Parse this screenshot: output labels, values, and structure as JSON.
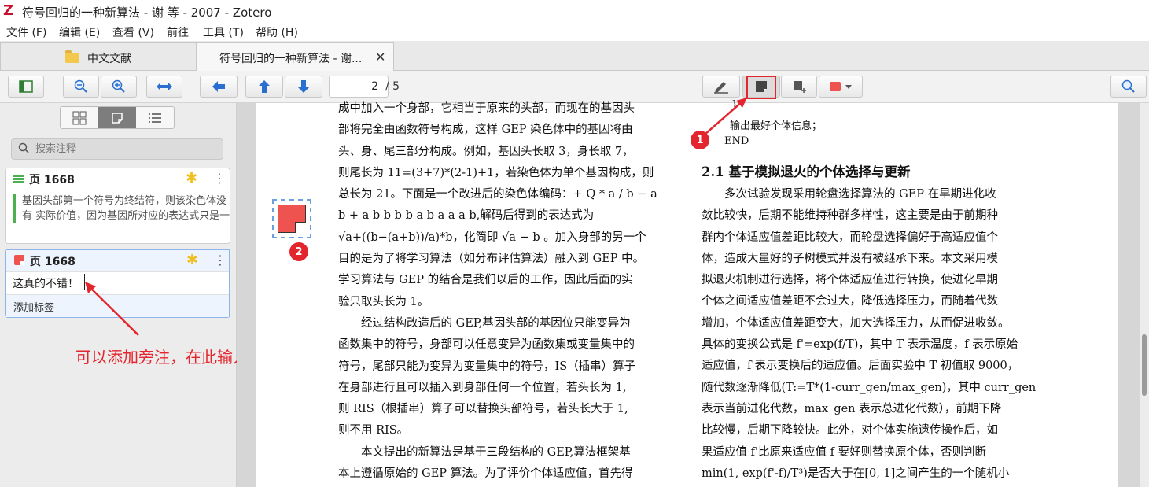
{
  "window": {
    "title": "符号回归的一种新算法 - 谢 等 - 2007 - Zotero",
    "app_logo": "Z"
  },
  "menu": [
    "文件 (F)",
    "编辑 (E)",
    "查看 (V)",
    "前往",
    "工具 (T)",
    "帮助 (H)"
  ],
  "tabs": [
    {
      "label": "中文文献",
      "icon": "folder-icon"
    },
    {
      "label": "符号回归的一种新算法 - 谢...",
      "icon": "none",
      "close": "✕"
    }
  ],
  "toolbar": {
    "current_page": "2",
    "total_pages": "/ 5"
  },
  "sidebar": {
    "search_placeholder": "搜索注释",
    "annotations": [
      {
        "page": "页 1668",
        "type": "highlight",
        "color": "#4caf50",
        "text": "基因头部第一个符号为终结符，则该染色体没有 实际价值，因为基因所对应的表达式只是一"
      },
      {
        "page": "页 1668",
        "type": "note",
        "color": "#ef5350",
        "comment": "这真的不错！",
        "tags_label": "添加标签"
      }
    ]
  },
  "hint_text": "可以添加旁注，在此输入内容",
  "badges": [
    "1",
    "2"
  ],
  "doc": {
    "left_lines": [
      "成中加入一个身部，它相当于原来的头部，而现在的基因头",
      "部将完全由函数符号构成，这样 GEP 染色体中的基因将由",
      "头、身、尾三部分构成。例如，基因头长取 3，身长取 7，",
      "则尾长为 11=(3+7)*(2-1)+1，若染色体为单个基因构成，则",
      "总长为 21。下面是一个改进后的染色体编码：+ Q * a / b − a",
      "b + a b b b b a b a a a b,解码后得到的表达式为",
      "√a+((b−(a+b))/a)*b，化简即 √a − b 。加入身部的另一个",
      "目的是为了将学习算法（如分布评估算法）融入到 GEP 中。",
      "学习算法与 GEP 的结合是我们以后的工作，因此后面的实",
      "验只取头长为 1。",
      "　　经过结构改造后的 GEP,基因头部的基因位只能变异为",
      "函数集中的符号，身部可以任意变异为函数集或变量集中的",
      "符号，尾部只能为变异为变量集中的符号，IS（插串）算子",
      "在身部进行且可以插入到身部任何一个位置，若头长为 1,",
      "则 RIS（根插串）算子可以替换头部符号，若头长大于 1,",
      "则不用 RIS。",
      "　　本文提出的新算法是基于三段结构的 GEP,算法框架基",
      "本上遵循原始的 GEP 算法。为了评价个体适应值，首先得"
    ],
    "code_lines": [
      "}",
      "输出最好个体信息；",
      "END"
    ],
    "section_heading": "2.1  基于模拟退火的个体选择与更新",
    "right_lines": [
      "　　多次试验发现采用轮盘选择算法的 GEP 在早期进化收",
      "敛比较快，后期不能维持种群多样性，这主要是由于前期种",
      "群内个体适应值差距比较大，而轮盘选择偏好于高适应值个",
      "体，造成大量好的子树模式并没有被继承下来。本文采用模",
      "拟退火机制进行选择，将个体适应值进行转换，使进化早期",
      "个体之间适应值差距不会过大，降低选择压力，而随着代数",
      "增加，个体适应值差距变大，加大选择压力，从而促进收敛。",
      "具体的变换公式是 f'=exp(f/T)，其中 T 表示温度，f 表示原始",
      "适应值，f'表示变换后的适应值。后面实验中 T 初值取 9000，",
      "随代数逐渐降低(T:=T*(1-curr_gen/max_gen)，其中 curr_gen",
      "表示当前进化代数，max_gen 表示总进化代数），前期下降",
      "比较慢，后期下降较快。此外，对个体实施遗传操作后，如",
      "果适应值 f'比原来适应值 f 要好则替换原个体，否则判断",
      "min(1, exp(f'-f)/T³)是否大于在[0, 1]之间产生的一个随机小"
    ]
  }
}
